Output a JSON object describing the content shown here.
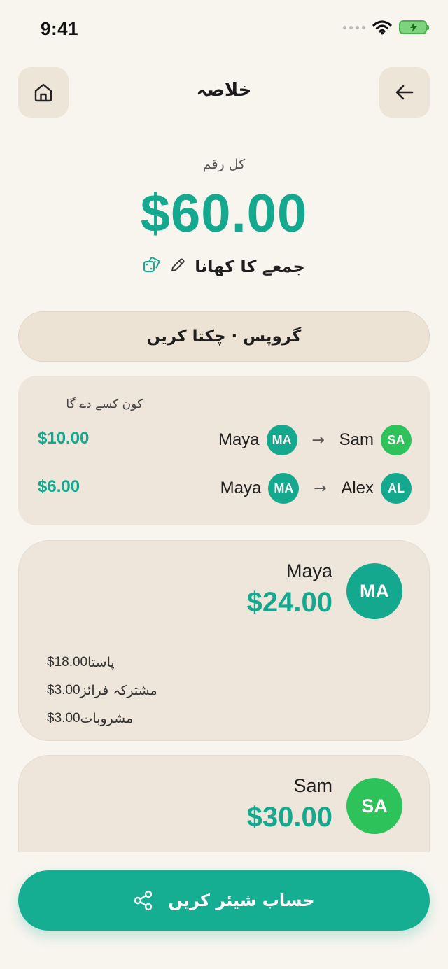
{
  "status": {
    "time": "9:41"
  },
  "header": {
    "title": "خلاصہ",
    "home_icon": "home-icon",
    "back_icon": "arrow-left-icon"
  },
  "summary": {
    "total_label": "کل رقم",
    "total_amount": "$60.00",
    "event_name": "جمعے کا کھانا"
  },
  "settle": {
    "label": "گروپس · چکتا کریں"
  },
  "who_pays": {
    "title": "کون کسے دے گا",
    "transfers": [
      {
        "from": "Maya",
        "from_initials": "MA",
        "to": "Sam",
        "to_initials": "SA",
        "amount": "$10.00"
      },
      {
        "from": "Maya",
        "from_initials": "MA",
        "to": "Alex",
        "to_initials": "AL",
        "amount": "$6.00"
      }
    ]
  },
  "people": [
    {
      "name": "Maya",
      "initials": "MA",
      "total": "$24.00",
      "items": [
        {
          "name": "پاستا",
          "price": "$18.00"
        },
        {
          "name": "مشترکہ فرائز",
          "price": "$3.00"
        },
        {
          "name": "مشروبات",
          "price": "$3.00"
        }
      ]
    },
    {
      "name": "Sam",
      "initials": "SA",
      "total": "$30.00",
      "items": []
    }
  ],
  "share": {
    "label": "حساب شیئر کریں"
  },
  "colors": {
    "accent": "#14a98f",
    "green": "#2ec25a",
    "card": "#eee6da",
    "background": "#f8f5ef"
  }
}
